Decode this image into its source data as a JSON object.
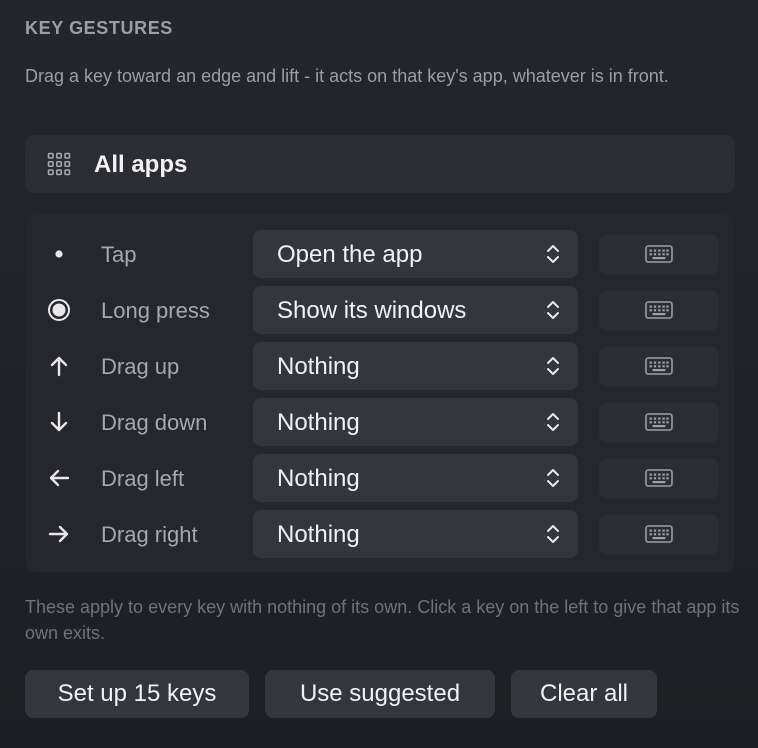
{
  "section": {
    "title": "KEY GESTURES",
    "description": "Drag a key toward an edge and lift - it acts on that key's app, whatever is in front."
  },
  "scope": {
    "icon": "grid-icon",
    "label": "All apps"
  },
  "gestures": [
    {
      "icon": "dot-icon",
      "label": "Tap",
      "value": "Open the app",
      "shortcut_icon": "keyboard-icon"
    },
    {
      "icon": "ring-icon",
      "label": "Long press",
      "value": "Show its windows",
      "shortcut_icon": "keyboard-icon"
    },
    {
      "icon": "arrow-up-icon",
      "label": "Drag up",
      "value": "Nothing",
      "shortcut_icon": "keyboard-icon"
    },
    {
      "icon": "arrow-down-icon",
      "label": "Drag down",
      "value": "Nothing",
      "shortcut_icon": "keyboard-icon"
    },
    {
      "icon": "arrow-left-icon",
      "label": "Drag left",
      "value": "Nothing",
      "shortcut_icon": "keyboard-icon"
    },
    {
      "icon": "arrow-right-icon",
      "label": "Drag right",
      "value": "Nothing",
      "shortcut_icon": "keyboard-icon"
    }
  ],
  "footnote": "These apply to every key with nothing of its own. Click a key on the left to give that app its own exits.",
  "buttons": {
    "setup": "Set up 15 keys",
    "suggested": "Use suggested",
    "clear": "Clear all"
  },
  "colors": {
    "background": "#1f2126",
    "panel": "#25272c",
    "control": "#34363d",
    "text_primary": "#f2f2f4",
    "text_secondary": "#a5a8b0",
    "text_muted": "#6f727a"
  }
}
